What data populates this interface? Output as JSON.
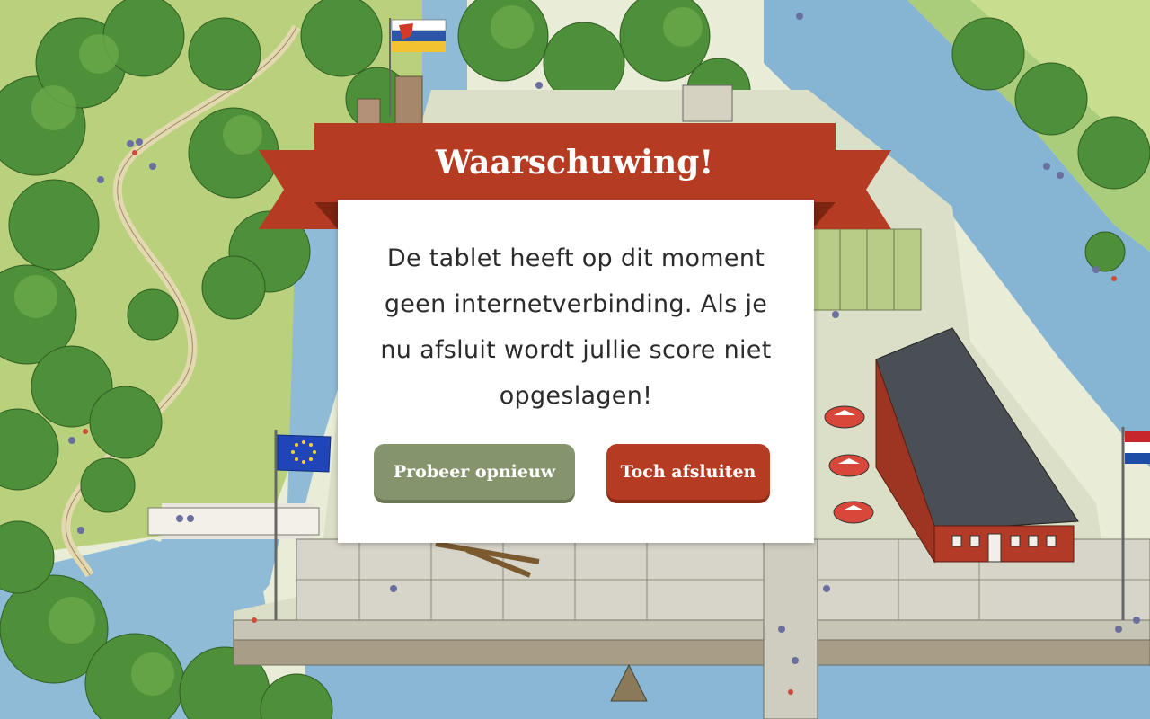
{
  "dialog": {
    "title": "Waarschuwing!",
    "message": "De tablet heeft op dit moment geen internetverbinding. Als je nu afsluit wordt jullie score niet opgeslagen!",
    "retry_label": "Probeer opnieuw",
    "close_label": "Toch afsluiten"
  },
  "colors": {
    "ribbon": "#b53c22",
    "ribbon_dark": "#7c2410",
    "retry_button": "#86946e",
    "close_button": "#b53c22",
    "dialog_background": "#ffffff"
  }
}
